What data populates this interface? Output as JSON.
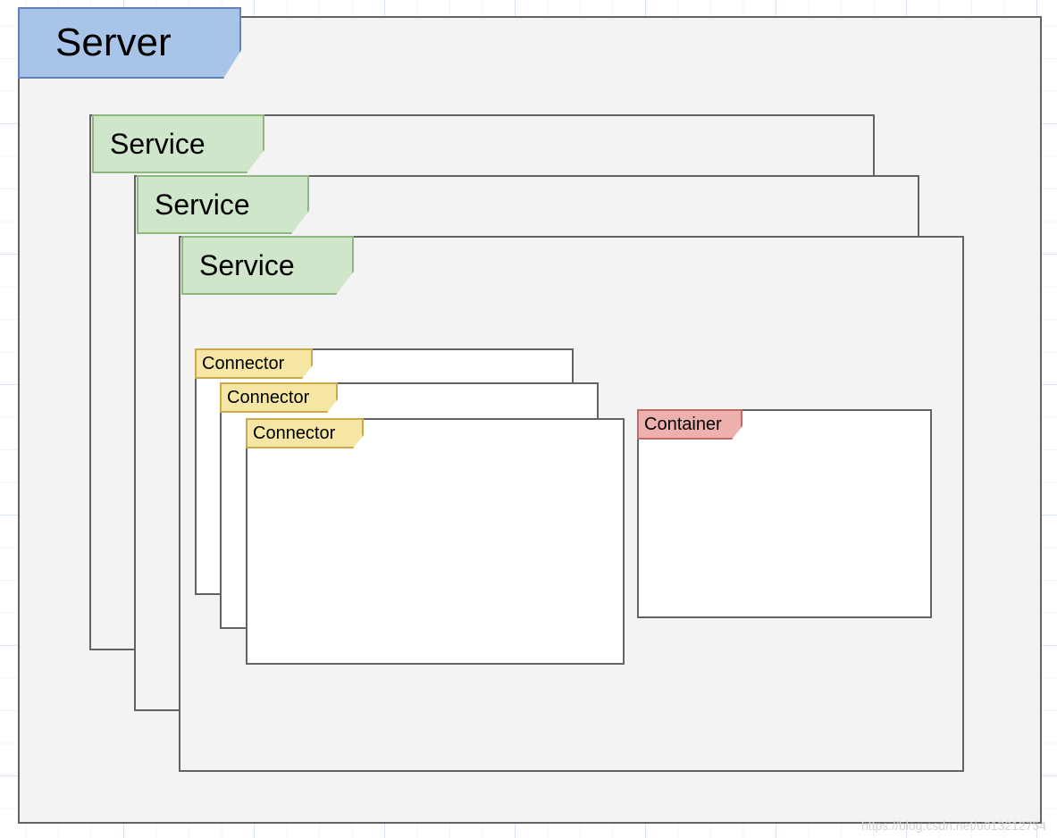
{
  "server": {
    "label": "Server"
  },
  "services": [
    {
      "label": "Service"
    },
    {
      "label": "Service"
    },
    {
      "label": "Service"
    }
  ],
  "connectors": [
    {
      "label": "Connector"
    },
    {
      "label": "Connector"
    },
    {
      "label": "Connector"
    }
  ],
  "container": {
    "label": "Container"
  },
  "watermark": "https://blog.csdn.net/u013212754",
  "colors": {
    "server_fill": "#a9c4e9",
    "server_stroke": "#6183b5",
    "service_fill": "#cfe6ca",
    "service_stroke": "#8fb780",
    "connector_fill": "#f5e6a3",
    "connector_stroke": "#c8a94d",
    "container_fill": "#eeb0ac",
    "container_stroke": "#c06b66",
    "box_fill": "#f3f3f3",
    "box_stroke": "#636363"
  }
}
